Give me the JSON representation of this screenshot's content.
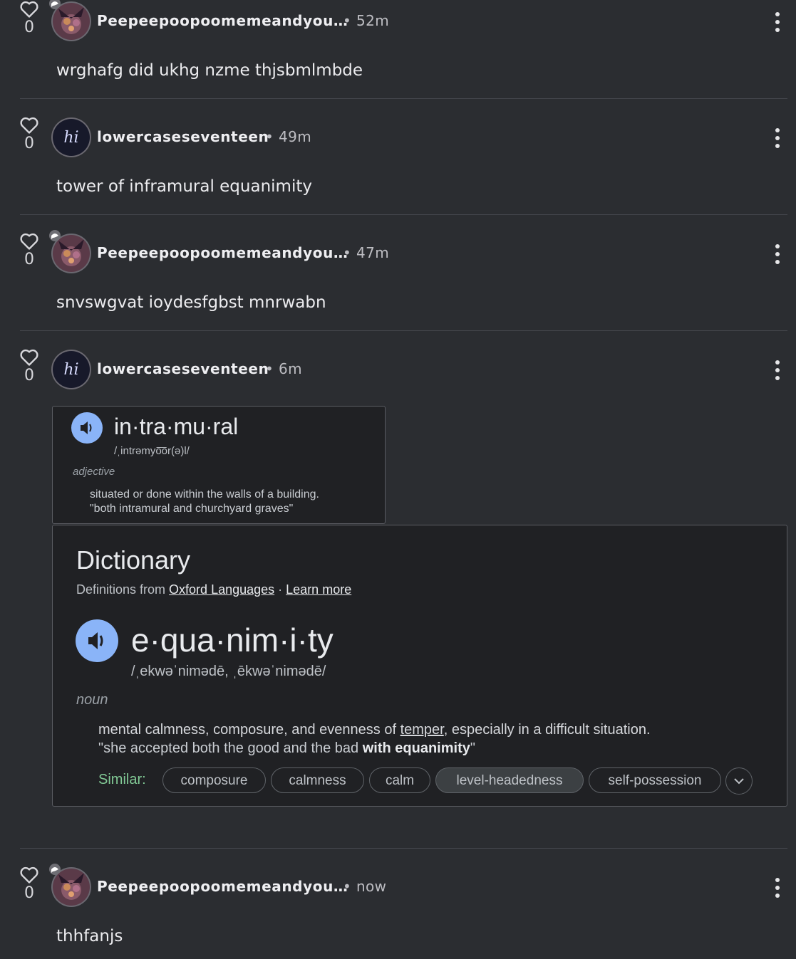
{
  "posts": [
    {
      "user": "Peepeepoopoomemeandyou…",
      "time": "• 52m",
      "likes": "0",
      "text": "wrghafg did ukhg nzme thjsbmlmbde"
    },
    {
      "user": "lowercaseseventeen",
      "time": "• 49m",
      "likes": "0",
      "text": "tower of inframural equanimity",
      "avatar_text": "hi"
    },
    {
      "user": "Peepeepoopoomemeandyou…",
      "time": "• 47m",
      "likes": "0",
      "text": "snvswgvat ioydesfgbst mnrwabn"
    },
    {
      "user": "lowercaseseventeen",
      "time": "• 6m",
      "likes": "0",
      "avatar_text": "hi"
    },
    {
      "user": "Peepeepoopoomemeandyou…",
      "time": "• now",
      "likes": "0",
      "text": "thhfanjs"
    }
  ],
  "card1": {
    "word": "in·tra·mu·ral",
    "pronunciation": "/ˌintrəmyo͞or(ə)l/",
    "pos": "adjective",
    "definition": "situated or done within the walls of a building.",
    "example": "\"both intramural and churchyard graves\""
  },
  "card2": {
    "title": "Dictionary",
    "sub_prefix": "Definitions from ",
    "source": "Oxford Languages",
    "sub_sep": " · ",
    "learn_more": "Learn more",
    "word": "e·qua·nim·i·ty",
    "pronunciation": "/ˌekwəˈnimədē, ˌēkwəˈnimədē/",
    "pos": "noun",
    "def_a": "mental calmness, composure, and evenness of ",
    "def_link": "temper",
    "def_b": ", especially in a difficult situation.",
    "ex_a": "\"she accepted both the good and the bad ",
    "ex_bold": "with equanimity",
    "ex_b": "\"",
    "similar_label": "Similar:",
    "chips": [
      "composure",
      "calmness",
      "calm",
      "level-headedness",
      "self-possession"
    ]
  },
  "colors": {
    "bg": "#2b2d31",
    "accent_blue": "#8ab4f8",
    "similar_green": "#81c995"
  }
}
